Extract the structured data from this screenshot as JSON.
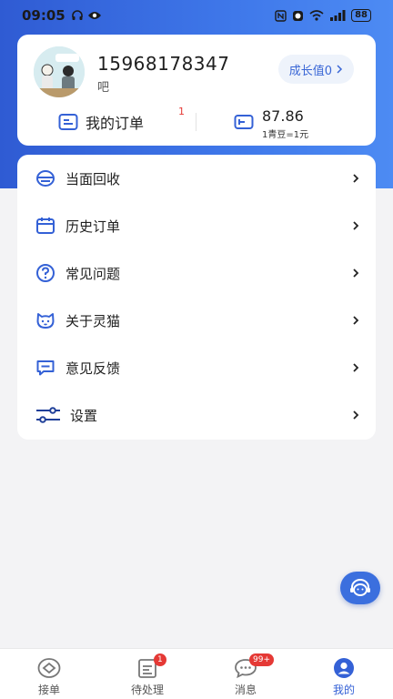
{
  "status_bar": {
    "time": "09:05",
    "battery": "88"
  },
  "profile": {
    "phone": "15968178347",
    "nickname": "吧",
    "growth_label": "成长值0",
    "orders_label": "我的订单",
    "orders_badge": "1",
    "beans_value": "87.86",
    "beans_rate": "1青豆=1元"
  },
  "menu": {
    "items": [
      {
        "label": "当面回收",
        "icon": "recycle-icon"
      },
      {
        "label": "历史订单",
        "icon": "calendar-icon"
      },
      {
        "label": "常见问题",
        "icon": "question-icon"
      },
      {
        "label": "关于灵猫",
        "icon": "cat-icon"
      },
      {
        "label": "意见反馈",
        "icon": "feedback-icon"
      },
      {
        "label": "设置",
        "icon": "settings-sliders-icon"
      }
    ]
  },
  "tabs": [
    {
      "label": "接单",
      "icon": "eye-icon"
    },
    {
      "label": "待处理",
      "icon": "clipboard-icon",
      "badge": "1"
    },
    {
      "label": "消息",
      "icon": "chat-icon",
      "badge": "99+"
    },
    {
      "label": "我的",
      "icon": "profile-icon"
    }
  ],
  "colors": {
    "accent": "#3461d6",
    "badge": "#e53935"
  }
}
